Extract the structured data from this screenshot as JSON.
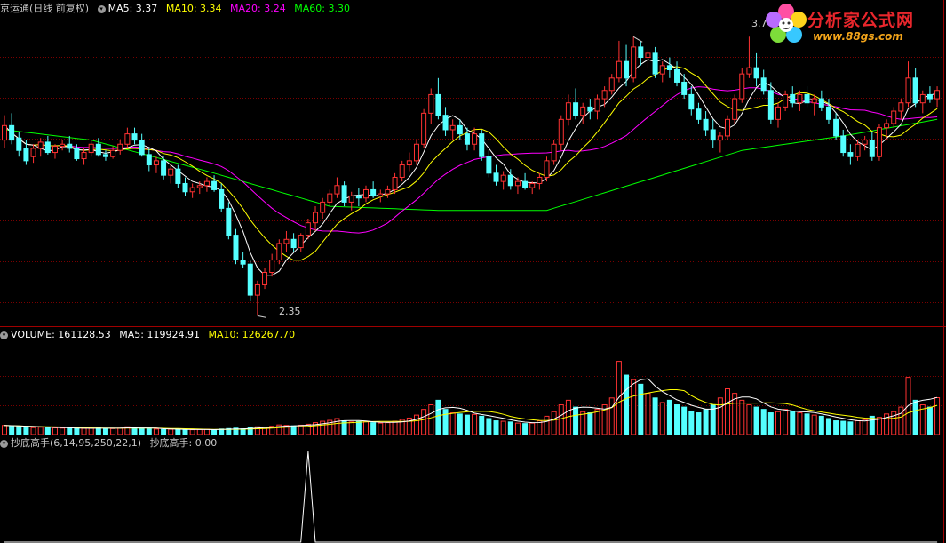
{
  "colors": {
    "background": "#000000",
    "up": "#ff3232",
    "down": "#54ffff",
    "grid": "#7a0000",
    "panel_border": "#a00000",
    "ma5": "#ffffff",
    "ma10": "#ffff00",
    "ma20": "#ff00ff",
    "ma60": "#00ff00",
    "indicator": "#ffffff"
  },
  "price_panel": {
    "title": "京运通(日线 前复权)",
    "ma5_label": "MA5: 3.37",
    "ma10_label": "MA10: 3.34",
    "ma20_label": "MA20: 3.24",
    "ma60_label": "MA60: 3.30",
    "high_mark": "3.7",
    "low_mark": "2.35",
    "toggle_icon": "circle-chevron-icon"
  },
  "volume_panel": {
    "volume_label": "VOLUME: 161128.53",
    "ma5_label": "MA5: 119924.91",
    "ma10_label": "MA10: 126267.70"
  },
  "indicator_panel": {
    "name_label": "抄底高手(6,14,95,250,22,1)",
    "value_label": "抄底高手: 0.00"
  },
  "logo": {
    "text": "分析家公式网",
    "url_text": "www.88gs.com",
    "icon": "flower-logo-icon"
  },
  "chart_data": {
    "type": "candlestick",
    "title": "京运通(日线 前复权)",
    "price_range": [
      2.3,
      3.8
    ],
    "volume_range": [
      0,
      400000
    ],
    "grid": true,
    "extremes": {
      "high": 3.7,
      "low": 2.35
    },
    "candles": [
      [
        3.2,
        3.32,
        3.16,
        3.27
      ],
      [
        3.27,
        3.33,
        3.18,
        3.2
      ],
      [
        3.21,
        3.24,
        3.12,
        3.15
      ],
      [
        3.16,
        3.2,
        3.08,
        3.1
      ],
      [
        3.12,
        3.18,
        3.09,
        3.16
      ],
      [
        3.16,
        3.21,
        3.12,
        3.19
      ],
      [
        3.19,
        3.22,
        3.13,
        3.14
      ],
      [
        3.14,
        3.18,
        3.11,
        3.17
      ],
      [
        3.17,
        3.2,
        3.15,
        3.18
      ],
      [
        3.18,
        3.22,
        3.14,
        3.16
      ],
      [
        3.16,
        3.18,
        3.1,
        3.11
      ],
      [
        3.11,
        3.16,
        3.08,
        3.14
      ],
      [
        3.14,
        3.2,
        3.12,
        3.18
      ],
      [
        3.18,
        3.21,
        3.12,
        3.13
      ],
      [
        3.13,
        3.15,
        3.1,
        3.12
      ],
      [
        3.12,
        3.17,
        3.11,
        3.15
      ],
      [
        3.15,
        3.2,
        3.13,
        3.18
      ],
      [
        3.18,
        3.26,
        3.16,
        3.23
      ],
      [
        3.23,
        3.26,
        3.18,
        3.2
      ],
      [
        3.2,
        3.23,
        3.12,
        3.13
      ],
      [
        3.13,
        3.16,
        3.05,
        3.08
      ],
      [
        3.08,
        3.12,
        3.04,
        3.1
      ],
      [
        3.1,
        3.12,
        3.01,
        3.03
      ],
      [
        3.03,
        3.08,
        2.99,
        3.06
      ],
      [
        3.06,
        3.08,
        2.97,
        2.99
      ],
      [
        2.99,
        3.02,
        2.93,
        2.95
      ],
      [
        2.95,
        2.99,
        2.92,
        2.97
      ],
      [
        2.97,
        3.0,
        2.94,
        2.98
      ],
      [
        2.98,
        3.02,
        2.95,
        3.0
      ],
      [
        3.0,
        3.03,
        2.95,
        2.96
      ],
      [
        2.96,
        2.99,
        2.85,
        2.87
      ],
      [
        2.87,
        2.9,
        2.72,
        2.74
      ],
      [
        2.74,
        2.77,
        2.6,
        2.62
      ],
      [
        2.62,
        2.66,
        2.58,
        2.6
      ],
      [
        2.6,
        2.62,
        2.42,
        2.45
      ],
      [
        2.45,
        2.52,
        2.35,
        2.5
      ],
      [
        2.5,
        2.58,
        2.48,
        2.56
      ],
      [
        2.56,
        2.65,
        2.54,
        2.62
      ],
      [
        2.62,
        2.72,
        2.6,
        2.7
      ],
      [
        2.7,
        2.76,
        2.66,
        2.72
      ],
      [
        2.72,
        2.75,
        2.66,
        2.68
      ],
      [
        2.68,
        2.75,
        2.66,
        2.74
      ],
      [
        2.74,
        2.82,
        2.72,
        2.8
      ],
      [
        2.8,
        2.88,
        2.76,
        2.85
      ],
      [
        2.85,
        2.92,
        2.82,
        2.9
      ],
      [
        2.9,
        2.96,
        2.88,
        2.94
      ],
      [
        2.94,
        3.02,
        2.92,
        2.98
      ],
      [
        2.98,
        3.0,
        2.88,
        2.9
      ],
      [
        2.9,
        2.95,
        2.86,
        2.93
      ],
      [
        2.93,
        2.97,
        2.88,
        2.92
      ],
      [
        2.92,
        2.98,
        2.9,
        2.96
      ],
      [
        2.96,
        3.0,
        2.92,
        2.93
      ],
      [
        2.93,
        2.96,
        2.9,
        2.94
      ],
      [
        2.94,
        2.98,
        2.92,
        2.96
      ],
      [
        2.96,
        3.04,
        2.94,
        3.02
      ],
      [
        3.02,
        3.1,
        3.0,
        3.08
      ],
      [
        3.08,
        3.14,
        3.05,
        3.1
      ],
      [
        3.1,
        3.2,
        3.08,
        3.18
      ],
      [
        3.18,
        3.35,
        3.16,
        3.33
      ],
      [
        3.33,
        3.45,
        3.28,
        3.42
      ],
      [
        3.42,
        3.5,
        3.3,
        3.32
      ],
      [
        3.32,
        3.36,
        3.22,
        3.25
      ],
      [
        3.25,
        3.3,
        3.2,
        3.27
      ],
      [
        3.27,
        3.3,
        3.2,
        3.23
      ],
      [
        3.23,
        3.26,
        3.15,
        3.18
      ],
      [
        3.18,
        3.26,
        3.15,
        3.23
      ],
      [
        3.23,
        3.25,
        3.1,
        3.12
      ],
      [
        3.12,
        3.15,
        3.02,
        3.04
      ],
      [
        3.04,
        3.08,
        2.98,
        3.0
      ],
      [
        3.0,
        3.05,
        2.96,
        3.03
      ],
      [
        3.03,
        3.06,
        2.96,
        2.98
      ],
      [
        2.98,
        3.02,
        2.94,
        3.0
      ],
      [
        3.0,
        3.04,
        2.96,
        2.97
      ],
      [
        2.97,
        3.0,
        2.94,
        2.99
      ],
      [
        2.99,
        3.04,
        2.96,
        3.02
      ],
      [
        3.02,
        3.12,
        3.0,
        3.1
      ],
      [
        3.1,
        3.2,
        3.08,
        3.18
      ],
      [
        3.18,
        3.32,
        3.15,
        3.3
      ],
      [
        3.3,
        3.42,
        3.27,
        3.38
      ],
      [
        3.38,
        3.45,
        3.3,
        3.32
      ],
      [
        3.32,
        3.38,
        3.28,
        3.36
      ],
      [
        3.36,
        3.4,
        3.3,
        3.34
      ],
      [
        3.34,
        3.42,
        3.3,
        3.4
      ],
      [
        3.4,
        3.46,
        3.36,
        3.44
      ],
      [
        3.44,
        3.52,
        3.42,
        3.5
      ],
      [
        3.5,
        3.68,
        3.48,
        3.58
      ],
      [
        3.58,
        3.66,
        3.46,
        3.5
      ],
      [
        3.5,
        3.7,
        3.48,
        3.65
      ],
      [
        3.65,
        3.68,
        3.56,
        3.6
      ],
      [
        3.6,
        3.64,
        3.55,
        3.62
      ],
      [
        3.62,
        3.65,
        3.5,
        3.52
      ],
      [
        3.52,
        3.58,
        3.48,
        3.56
      ],
      [
        3.56,
        3.6,
        3.5,
        3.54
      ],
      [
        3.54,
        3.58,
        3.46,
        3.48
      ],
      [
        3.48,
        3.52,
        3.4,
        3.42
      ],
      [
        3.42,
        3.46,
        3.32,
        3.35
      ],
      [
        3.35,
        3.38,
        3.28,
        3.3
      ],
      [
        3.3,
        3.34,
        3.22,
        3.25
      ],
      [
        3.25,
        3.3,
        3.16,
        3.2
      ],
      [
        3.2,
        3.24,
        3.14,
        3.22
      ],
      [
        3.22,
        3.32,
        3.2,
        3.3
      ],
      [
        3.3,
        3.42,
        3.28,
        3.4
      ],
      [
        3.4,
        3.55,
        3.38,
        3.52
      ],
      [
        3.52,
        3.7,
        3.5,
        3.55
      ],
      [
        3.55,
        3.62,
        3.46,
        3.5
      ],
      [
        3.5,
        3.54,
        3.42,
        3.44
      ],
      [
        3.44,
        3.48,
        3.28,
        3.3
      ],
      [
        3.3,
        3.38,
        3.26,
        3.36
      ],
      [
        3.36,
        3.44,
        3.34,
        3.42
      ],
      [
        3.42,
        3.46,
        3.36,
        3.38
      ],
      [
        3.38,
        3.44,
        3.34,
        3.42
      ],
      [
        3.42,
        3.46,
        3.36,
        3.38
      ],
      [
        3.38,
        3.42,
        3.32,
        3.4
      ],
      [
        3.4,
        3.44,
        3.34,
        3.36
      ],
      [
        3.36,
        3.4,
        3.28,
        3.3
      ],
      [
        3.3,
        3.33,
        3.2,
        3.22
      ],
      [
        3.22,
        3.25,
        3.12,
        3.14
      ],
      [
        3.14,
        3.18,
        3.08,
        3.12
      ],
      [
        3.12,
        3.2,
        3.1,
        3.18
      ],
      [
        3.18,
        3.22,
        3.15,
        3.2
      ],
      [
        3.2,
        3.24,
        3.1,
        3.12
      ],
      [
        3.12,
        3.28,
        3.1,
        3.26
      ],
      [
        3.26,
        3.3,
        3.2,
        3.28
      ],
      [
        3.28,
        3.36,
        3.26,
        3.34
      ],
      [
        3.34,
        3.4,
        3.3,
        3.38
      ],
      [
        3.38,
        3.58,
        3.36,
        3.5
      ],
      [
        3.5,
        3.55,
        3.36,
        3.38
      ],
      [
        3.38,
        3.44,
        3.33,
        3.42
      ],
      [
        3.42,
        3.46,
        3.38,
        3.4
      ],
      [
        3.4,
        3.46,
        3.36,
        3.44
      ]
    ],
    "volume": [
      40000,
      38000,
      35000,
      33000,
      30000,
      32000,
      31000,
      29000,
      28000,
      27000,
      26000,
      27000,
      28000,
      30000,
      27000,
      26000,
      28000,
      34000,
      30000,
      26000,
      25000,
      24000,
      22000,
      23000,
      22000,
      20000,
      21000,
      22000,
      23000,
      21000,
      24000,
      26000,
      28000,
      25000,
      30000,
      34000,
      32000,
      36000,
      42000,
      40000,
      38000,
      41000,
      45000,
      52000,
      58000,
      62000,
      70000,
      60000,
      55000,
      57000,
      56000,
      52000,
      50000,
      52000,
      58000,
      66000,
      72000,
      85000,
      110000,
      130000,
      150000,
      110000,
      95000,
      90000,
      85000,
      88000,
      80000,
      70000,
      60000,
      58000,
      55000,
      50000,
      48000,
      50000,
      60000,
      80000,
      100000,
      130000,
      150000,
      120000,
      100000,
      95000,
      110000,
      130000,
      160000,
      320000,
      260000,
      240000,
      220000,
      180000,
      160000,
      140000,
      150000,
      130000,
      120000,
      100000,
      95000,
      110000,
      130000,
      160000,
      200000,
      180000,
      150000,
      130000,
      120000,
      110000,
      95000,
      100000,
      110000,
      100000,
      95000,
      90000,
      85000,
      80000,
      70000,
      60000,
      58000,
      55000,
      60000,
      65000,
      80000,
      75000,
      90000,
      100000,
      120000,
      250000,
      150000,
      130000,
      120000,
      161128.53
    ],
    "indicator": {
      "name": "抄底高手",
      "range": [
        0,
        1
      ],
      "signals": [
        {
          "index": 42,
          "value": 1
        }
      ]
    },
    "series": [
      {
        "name": "MA5",
        "color": "#ffffff"
      },
      {
        "name": "MA10",
        "color": "#ffff00"
      },
      {
        "name": "MA20",
        "color": "#ff00ff"
      },
      {
        "name": "MA60",
        "color": "#00ff00",
        "anchors": [
          [
            0,
            3.25
          ],
          [
            12,
            3.2
          ],
          [
            28,
            3.05
          ],
          [
            45,
            2.88
          ],
          [
            60,
            2.86
          ],
          [
            75,
            2.86
          ],
          [
            90,
            3.02
          ],
          [
            102,
            3.15
          ],
          [
            116,
            3.22
          ],
          [
            129,
            3.3
          ]
        ]
      }
    ]
  }
}
